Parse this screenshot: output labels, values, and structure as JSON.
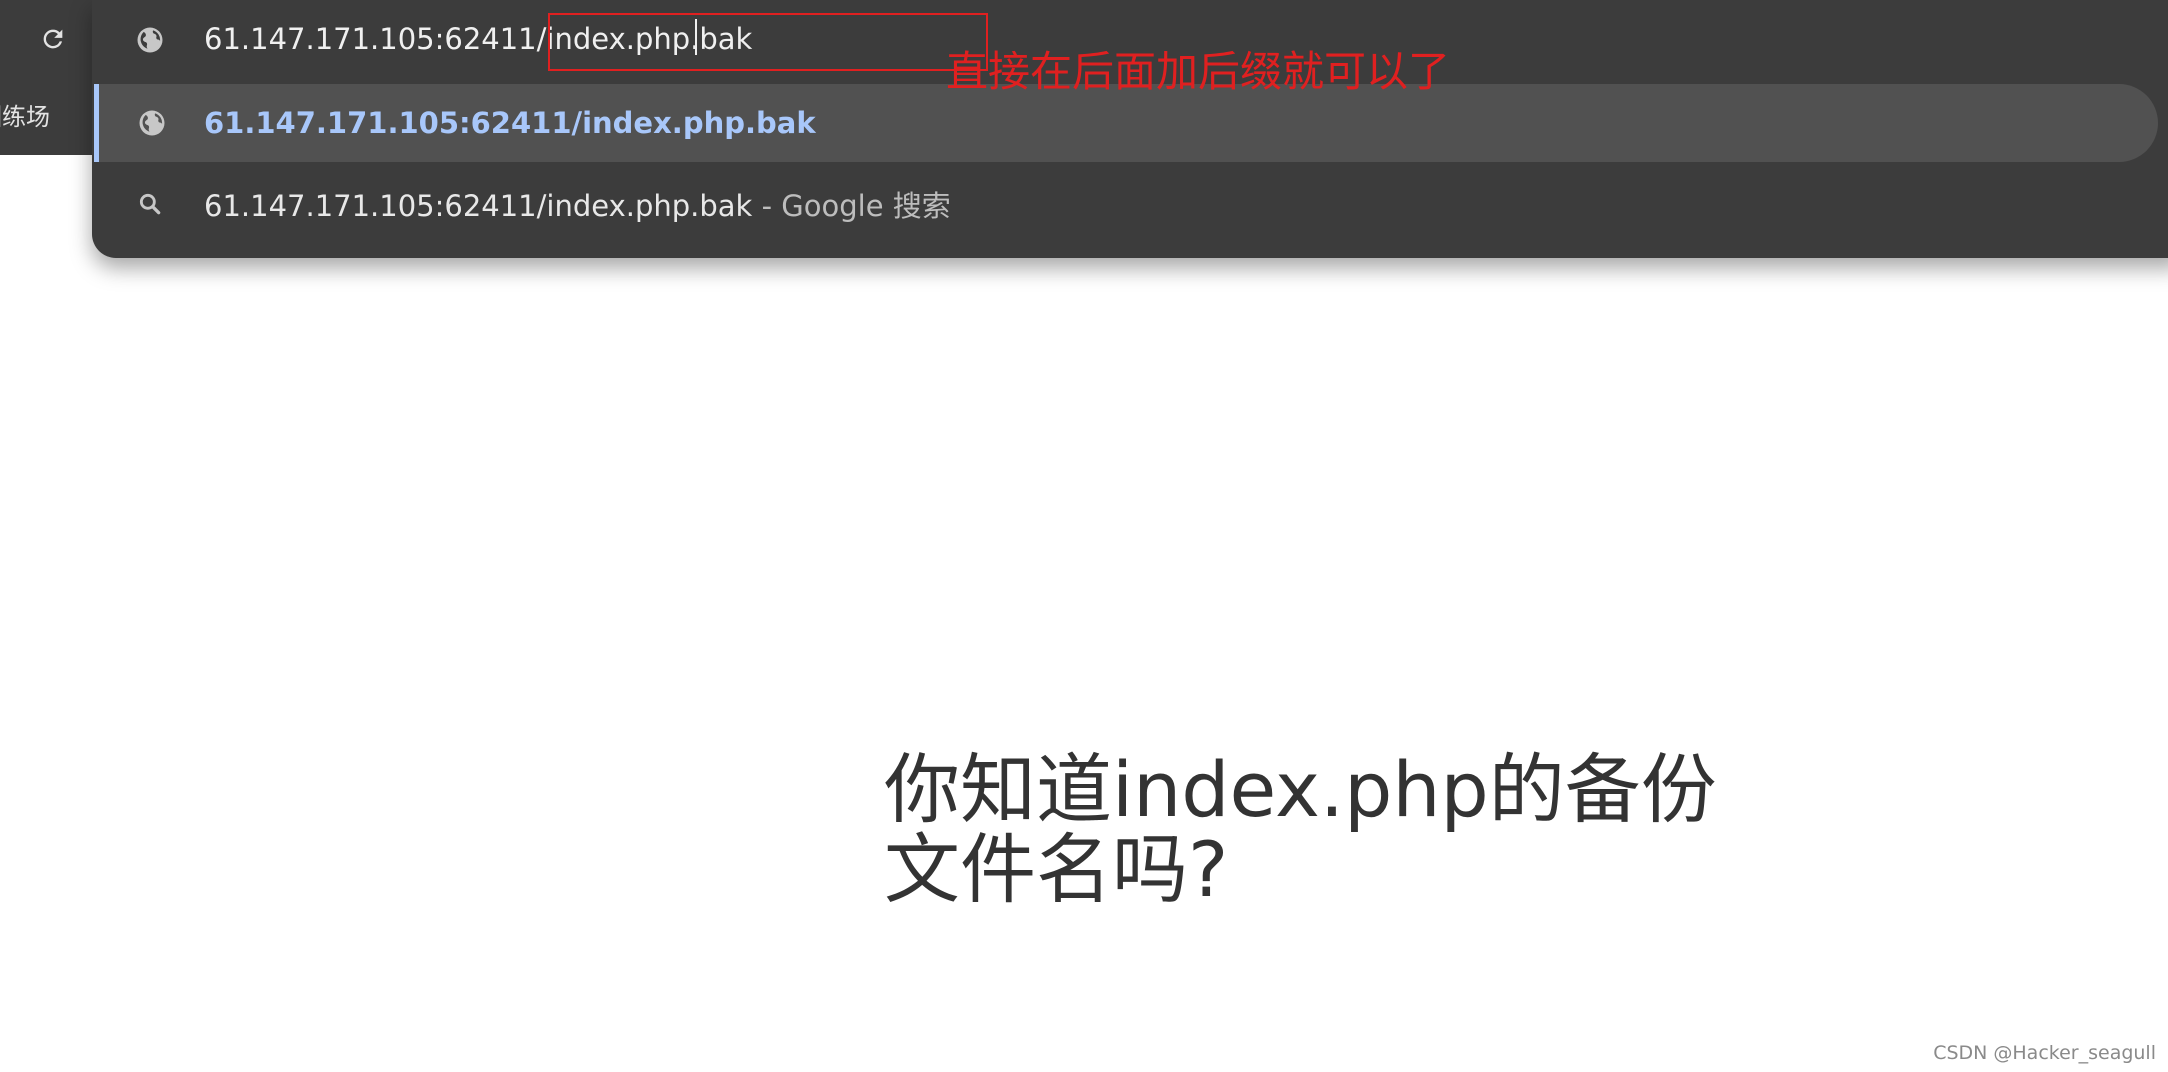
{
  "browser": {
    "bookmark": "训练场",
    "address_bar": {
      "value": "61.147.171.105:62411/index.php.bak",
      "icon": "globe-icon"
    },
    "suggestions": [
      {
        "icon": "globe-icon",
        "url": "61.147.171.105:62411/index.php.bak"
      },
      {
        "icon": "search-icon",
        "query": "61.147.171.105:62411/index.php.bak",
        "separator": "-",
        "engine": "Google 搜索"
      }
    ]
  },
  "annotation": {
    "text": "直接在后面加后缀就可以了",
    "color": "#e02020"
  },
  "page": {
    "heading": "你知道index.php的备份文件名吗?"
  },
  "watermark": "CSDN @Hacker_seagull",
  "colors": {
    "omnibox_bg": "#3c3c3c",
    "suggestion_highlight": "#515151",
    "link_blue": "#a8c7fa"
  }
}
